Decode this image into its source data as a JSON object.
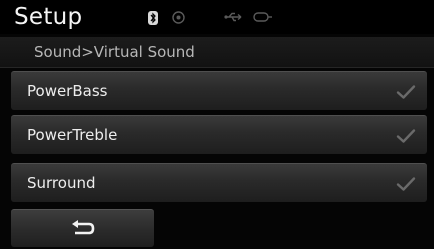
{
  "header": {
    "title": "Setup",
    "status_icons": [
      "bluetooth-icon",
      "record-icon",
      "usb-icon",
      "aux-icon"
    ]
  },
  "breadcrumb": {
    "text": "Sound>Virtual Sound"
  },
  "menu": {
    "items": [
      {
        "label": "PowerBass",
        "checked": true
      },
      {
        "label": "PowerTreble",
        "checked": true
      },
      {
        "label": "Surround",
        "checked": true
      }
    ]
  },
  "footer": {
    "back_icon": "back-arrow-icon"
  },
  "colors": {
    "background": "#050505",
    "button_top": "#3a3a3a",
    "button_bottom": "#1e1e1e",
    "text": "#ededed",
    "checkmark": "#6a6a6a"
  }
}
